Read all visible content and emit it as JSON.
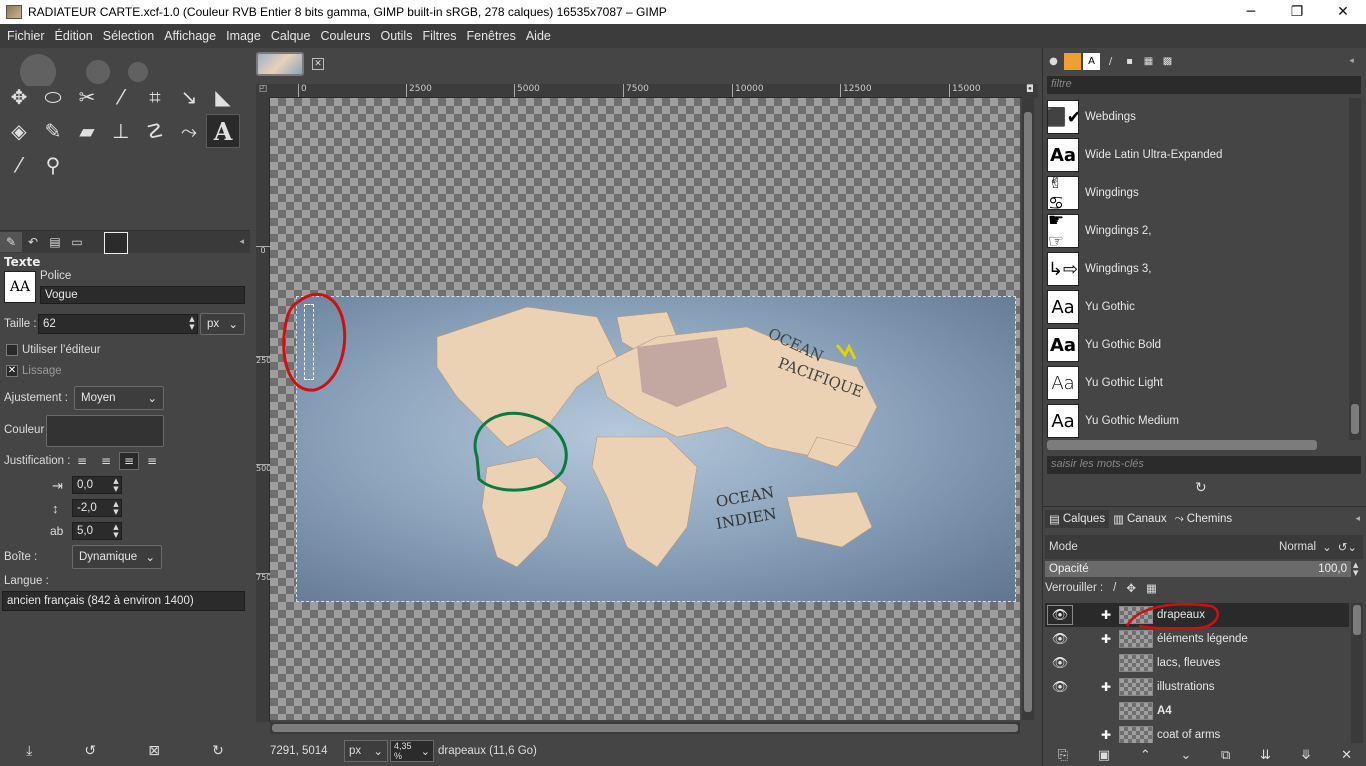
{
  "window": {
    "title": "RADIATEUR CARTE.xcf-1.0 (Couleur RVB Entier 8 bits gamma, GIMP built-in sRGB, 278 calques) 16535x7087 – GIMP",
    "minimize": "─",
    "maximize": "❐",
    "close": "✕"
  },
  "menu": [
    "Fichier",
    "Édition",
    "Sélection",
    "Affichage",
    "Image",
    "Calque",
    "Couleurs",
    "Outils",
    "Filtres",
    "Fenêtres",
    "Aide"
  ],
  "tools": [
    {
      "name": "move-tool-icon",
      "glyph": "✥"
    },
    {
      "name": "ellipse-select-icon",
      "glyph": "⬭"
    },
    {
      "name": "scissors-select-icon",
      "glyph": "✂"
    },
    {
      "name": "fuzzy-select-icon",
      "glyph": "⁄"
    },
    {
      "name": "crop-tool-icon",
      "glyph": "⌗"
    },
    {
      "name": "transform-tool-icon",
      "glyph": "↘"
    },
    {
      "name": "warp-tool-icon",
      "glyph": "◣"
    },
    {
      "name": "bucket-fill-icon",
      "glyph": "◈"
    },
    {
      "name": "paintbrush-icon",
      "glyph": "✎"
    },
    {
      "name": "eraser-icon",
      "glyph": "▰"
    },
    {
      "name": "clone-tool-icon",
      "glyph": "⊥"
    },
    {
      "name": "smudge-tool-icon",
      "glyph": "☡"
    },
    {
      "name": "paths-tool-icon",
      "glyph": "⤳"
    },
    {
      "name": "text-tool-icon",
      "glyph": "A"
    },
    {
      "name": "color-picker-icon",
      "glyph": "⁄"
    },
    {
      "name": "zoom-tool-icon",
      "glyph": "⚲"
    }
  ],
  "tool_options": {
    "title": "Texte",
    "font_label": "Police",
    "font_value": "Vogue",
    "font_preview": "AA",
    "size_label": "Taille :",
    "size_value": "62",
    "size_unit": "px",
    "use_editor_label": "Utiliser l’éditeur",
    "antialias_label": "Lissage",
    "hinting_label": "Ajustement :",
    "hinting_value": "Moyen",
    "color_label": "Couleur :",
    "justify_label": "Justification :",
    "indent_value": "0,0",
    "line_spacing_value": "-2,0",
    "letter_spacing_value": "5,0",
    "box_label": "Boîte :",
    "box_value": "Dynamique",
    "language_label": "Langue :",
    "language_value": "ancien français (842 à environ 1400)"
  },
  "canvas": {
    "ruler_ticks": [
      "0",
      "2500",
      "5000",
      "7500",
      "10000",
      "12500",
      "15000"
    ],
    "vruler_ticks": [
      "0",
      "2500",
      "5000",
      "7500"
    ]
  },
  "status": {
    "coords": "7291, 5014",
    "unit": "px",
    "zoom": "4,35 %",
    "layer_info": "drapeaux (11,6 Go)"
  },
  "fonts_panel": {
    "filter_placeholder": "filtre",
    "tags_placeholder": "saisir les mots-clés",
    "fonts": [
      {
        "name": "Webdings",
        "preview": "⬛✔"
      },
      {
        "name": "Wide Latin Ultra-Expanded",
        "preview": "Aa"
      },
      {
        "name": "Wingdings",
        "preview": "✌♋"
      },
      {
        "name": "Wingdings 2,",
        "preview": "☛☞"
      },
      {
        "name": "Wingdings 3,",
        "preview": "↳⇨"
      },
      {
        "name": "Yu Gothic",
        "preview": "Aa"
      },
      {
        "name": "Yu Gothic Bold",
        "preview": "Aa"
      },
      {
        "name": "Yu Gothic Light",
        "preview": "Aa"
      },
      {
        "name": "Yu Gothic Medium",
        "preview": "Aa"
      }
    ]
  },
  "layers_panel": {
    "tab_layers": "Calques",
    "tab_channels": "Canaux",
    "tab_paths": "Chemins",
    "mode_label": "Mode",
    "mode_value": "Normal",
    "opacity_label": "Opacité",
    "opacity_value": "100,0",
    "lock_label": "Verrouiller :",
    "layers": [
      {
        "name": "drapeaux",
        "visible": true,
        "chain": true,
        "bold": false
      },
      {
        "name": "éléments légende",
        "visible": true,
        "chain": true,
        "bold": false
      },
      {
        "name": "lacs, fleuves",
        "visible": true,
        "chain": false,
        "bold": false
      },
      {
        "name": "illustrations",
        "visible": true,
        "chain": true,
        "bold": false
      },
      {
        "name": "A4",
        "visible": false,
        "chain": false,
        "bold": true
      },
      {
        "name": "coat of arms",
        "visible": false,
        "chain": true,
        "bold": false
      }
    ]
  },
  "map_labels": {
    "pacific": [
      "OCEAN",
      "PACIFIQUE"
    ],
    "indian": [
      "OCEAN",
      "INDIEN"
    ]
  }
}
